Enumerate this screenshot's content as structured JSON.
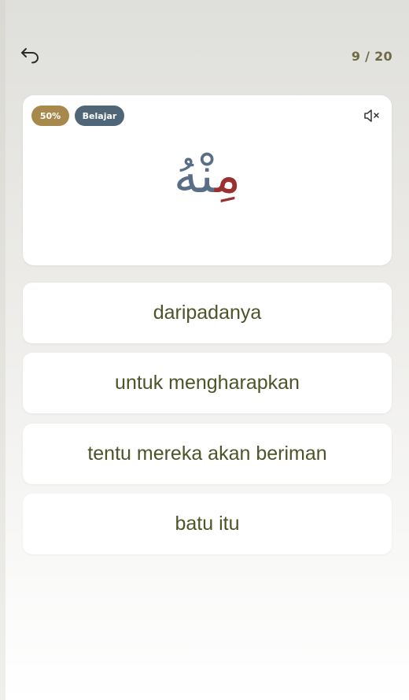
{
  "header": {
    "back_icon": "undo-arrow-icon",
    "progress": "9 / 20"
  },
  "card": {
    "badges": {
      "percent": "50%",
      "mode": "Belajar"
    },
    "mute_icon": "speaker-muted-icon",
    "word_parts": [
      "مِ",
      "نْهُ"
    ],
    "word_colors": [
      "#9b3030",
      "#5a6d86"
    ]
  },
  "options": [
    "daripadanya",
    "untuk mengharapkan",
    "tentu mereka akan beriman",
    "batu itu"
  ],
  "colors": {
    "progress_text": "#6f6a42",
    "badge_percent": "#a8894d",
    "badge_mode": "#4e6677",
    "option_text": "#4e5328"
  }
}
